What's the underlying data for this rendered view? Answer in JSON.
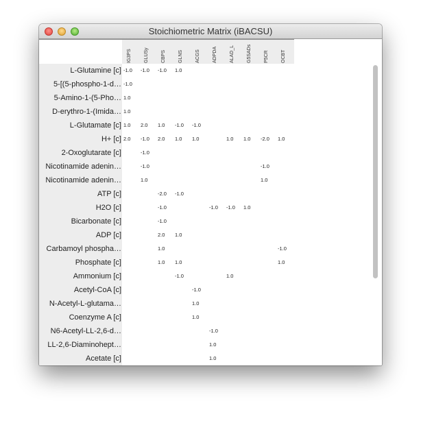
{
  "window": {
    "title": "Stoichiometric Matrix (iBACSU)"
  },
  "columns": [
    "IG3PS",
    "GLUSy",
    "CBPS",
    "GLNS",
    "ACGS",
    "ADPDA",
    "ALAD_L",
    "G5SADs",
    "P5CR",
    "OCBT"
  ],
  "rows": [
    {
      "label": "L-Glutamine [c]",
      "values": [
        "-1.0",
        "-1.0",
        "-1.0",
        "1.0",
        "",
        "",
        "",
        "",
        "",
        ""
      ]
    },
    {
      "label": "5-[(5-phospho-1-d…",
      "values": [
        "-1.0",
        "",
        "",
        "",
        "",
        "",
        "",
        "",
        "",
        ""
      ]
    },
    {
      "label": "5-Amino-1-(5-Pho…",
      "values": [
        "1.0",
        "",
        "",
        "",
        "",
        "",
        "",
        "",
        "",
        ""
      ]
    },
    {
      "label": "D-erythro-1-(Imida…",
      "values": [
        "1.0",
        "",
        "",
        "",
        "",
        "",
        "",
        "",
        "",
        ""
      ]
    },
    {
      "label": "L-Glutamate [c]",
      "values": [
        "1.0",
        "2.0",
        "1.0",
        "-1.0",
        "-1.0",
        "",
        "",
        "",
        "",
        ""
      ]
    },
    {
      "label": "H+ [c]",
      "values": [
        "2.0",
        "-1.0",
        "2.0",
        "1.0",
        "1.0",
        "",
        "1.0",
        "1.0",
        "-2.0",
        "1.0"
      ]
    },
    {
      "label": "2-Oxoglutarate [c]",
      "values": [
        "",
        "-1.0",
        "",
        "",
        "",
        "",
        "",
        "",
        "",
        ""
      ]
    },
    {
      "label": "Nicotinamide adenin…",
      "values": [
        "",
        "-1.0",
        "",
        "",
        "",
        "",
        "",
        "",
        "-1.0",
        ""
      ]
    },
    {
      "label": "Nicotinamide adenin…",
      "values": [
        "",
        "1.0",
        "",
        "",
        "",
        "",
        "",
        "",
        "1.0",
        ""
      ]
    },
    {
      "label": "ATP [c]",
      "values": [
        "",
        "",
        "-2.0",
        "-1.0",
        "",
        "",
        "",
        "",
        "",
        ""
      ]
    },
    {
      "label": "H2O [c]",
      "values": [
        "",
        "",
        "-1.0",
        "",
        "",
        "-1.0",
        "-1.0",
        "1.0",
        "",
        ""
      ]
    },
    {
      "label": "Bicarbonate [c]",
      "values": [
        "",
        "",
        "-1.0",
        "",
        "",
        "",
        "",
        "",
        "",
        ""
      ]
    },
    {
      "label": "ADP [c]",
      "values": [
        "",
        "",
        "2.0",
        "1.0",
        "",
        "",
        "",
        "",
        "",
        ""
      ]
    },
    {
      "label": "Carbamoyl phospha…",
      "values": [
        "",
        "",
        "1.0",
        "",
        "",
        "",
        "",
        "",
        "",
        "-1.0"
      ]
    },
    {
      "label": "Phosphate [c]",
      "values": [
        "",
        "",
        "1.0",
        "1.0",
        "",
        "",
        "",
        "",
        "",
        "1.0"
      ]
    },
    {
      "label": "Ammonium [c]",
      "values": [
        "",
        "",
        "",
        "-1.0",
        "",
        "",
        "1.0",
        "",
        "",
        ""
      ]
    },
    {
      "label": "Acetyl-CoA [c]",
      "values": [
        "",
        "",
        "",
        "",
        "-1.0",
        "",
        "",
        "",
        "",
        ""
      ]
    },
    {
      "label": "N-Acetyl-L-glutama…",
      "values": [
        "",
        "",
        "",
        "",
        "1.0",
        "",
        "",
        "",
        "",
        ""
      ]
    },
    {
      "label": "Coenzyme A [c]",
      "values": [
        "",
        "",
        "",
        "",
        "1.0",
        "",
        "",
        "",
        "",
        ""
      ]
    },
    {
      "label": "N6-Acetyl-LL-2,6-d…",
      "values": [
        "",
        "",
        "",
        "",
        "",
        "-1.0",
        "",
        "",
        "",
        ""
      ]
    },
    {
      "label": "LL-2,6-Diaminohept…",
      "values": [
        "",
        "",
        "",
        "",
        "",
        "1.0",
        "",
        "",
        "",
        ""
      ]
    },
    {
      "label": "Acetate [c]",
      "values": [
        "",
        "",
        "",
        "",
        "",
        "1.0",
        "",
        "",
        "",
        ""
      ]
    }
  ]
}
